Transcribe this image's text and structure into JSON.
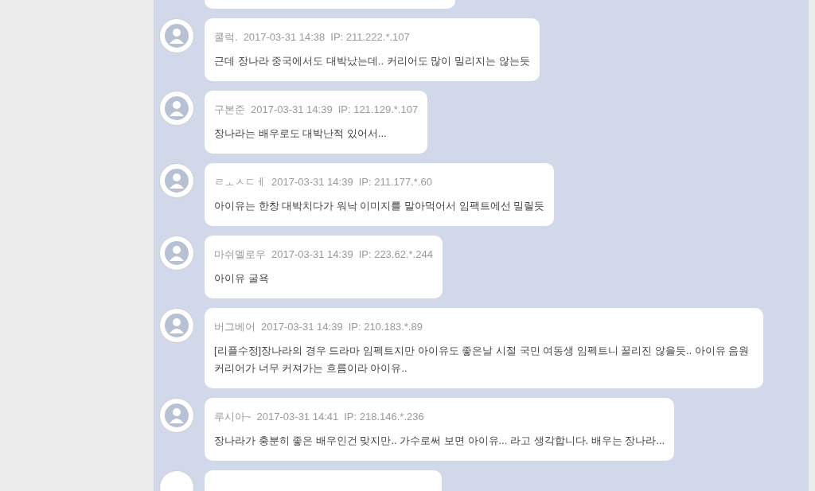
{
  "cut_off": {
    "above": true,
    "below": true
  },
  "comments": [
    {
      "author": "쿨럭.",
      "date": "2017-03-31 14:38",
      "ip": "IP: 211.222.*.107",
      "text": "근데 장나라 중국에서도 대박났는데.. 커리어도 많이 밀리지는 않는듯"
    },
    {
      "author": "구본준",
      "date": "2017-03-31 14:39",
      "ip": "IP: 121.129.*.107",
      "text": "장나라는 배우로도 대박난적 있어서..."
    },
    {
      "author": "ㄹㅗㅅㄷㅔ",
      "date": "2017-03-31 14:39",
      "ip": "IP: 211.177.*.60",
      "text": "아이유는 한창 대박치다가 워낙 이미지를 말아먹어서 임팩트에선 밀릴듯"
    },
    {
      "author": "마쉬멜로우",
      "date": "2017-03-31 14:39",
      "ip": "IP: 223.62.*.244",
      "text": "아이유 굴욕"
    },
    {
      "author": "버그베어",
      "date": "2017-03-31 14:39",
      "ip": "IP: 210.183.*.89",
      "text": "[리플수정]장나라의 경우 드라마 임펙트지만 아이유도 좋은날 시절 국민 여동생 임펙트니 꿀리진 않을듯.. 아이유 음원 커리어가 너무 커져가는 흐름이라 아이유.."
    },
    {
      "author": "루시아~",
      "date": "2017-03-31 14:41",
      "ip": "IP: 218.146.*.236",
      "text": "장나라가 충분히 좋은 배우인건 맞지만.. 가수로써 보면 아이유... 라고 생각합니다. 배우는 장나라..."
    }
  ]
}
